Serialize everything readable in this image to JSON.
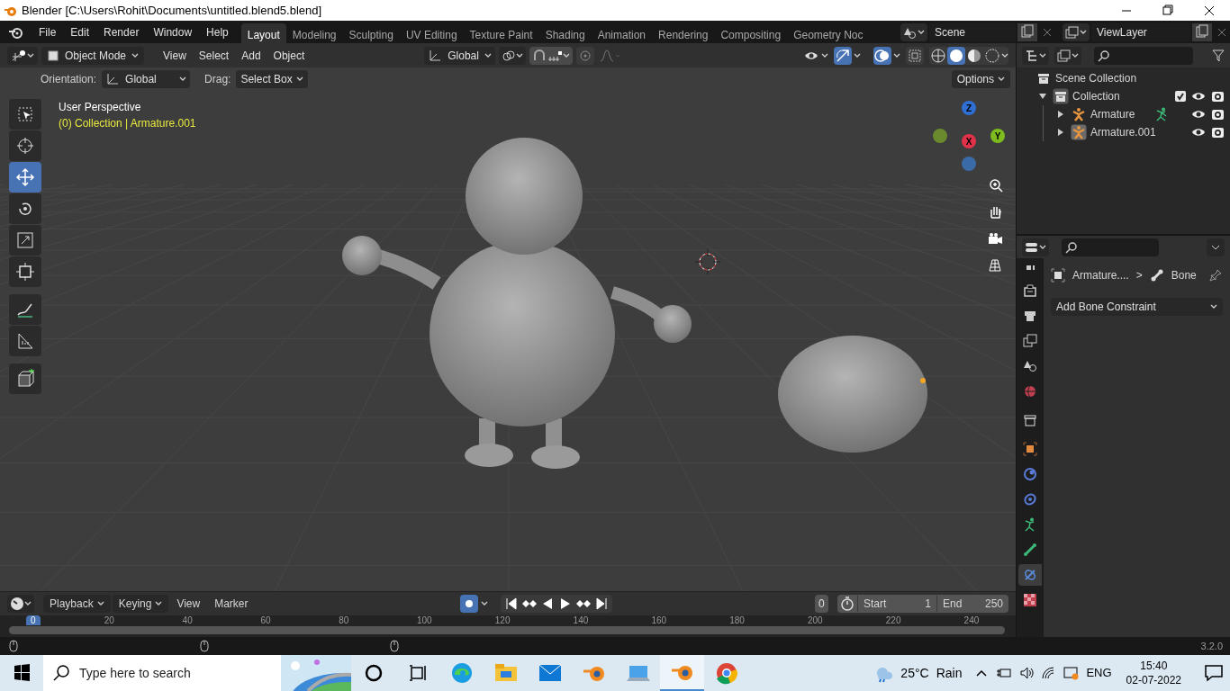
{
  "window": {
    "title": "Blender [C:\\Users\\Rohit\\Documents\\untitled.blend5.blend]"
  },
  "menu": [
    "File",
    "Edit",
    "Render",
    "Window",
    "Help"
  ],
  "workspaces": [
    {
      "label": "Layout",
      "selected": true
    },
    {
      "label": "Modeling",
      "selected": false
    },
    {
      "label": "Sculpting",
      "selected": false
    },
    {
      "label": "UV Editing",
      "selected": false
    },
    {
      "label": "Texture Paint",
      "selected": false
    },
    {
      "label": "Shading",
      "selected": false
    },
    {
      "label": "Animation",
      "selected": false
    },
    {
      "label": "Rendering",
      "selected": false
    },
    {
      "label": "Compositing",
      "selected": false
    },
    {
      "label": "Geometry Noc",
      "selected": false
    }
  ],
  "scene": "Scene",
  "view_layer": "ViewLayer",
  "viewport_header": {
    "mode": "Object Mode",
    "menus": [
      "View",
      "Select",
      "Add",
      "Object"
    ],
    "transform_orientation": "Global",
    "snap": true,
    "gizmos": true,
    "overlays": true,
    "shading": [
      {
        "kind": "wireframe",
        "selected": false
      },
      {
        "kind": "solid",
        "selected": true
      },
      {
        "kind": "material",
        "selected": false
      },
      {
        "kind": "rendered",
        "selected": false
      }
    ]
  },
  "tool_settings": {
    "orientation_label": "Orientation:",
    "orientation": "Global",
    "drag_label": "Drag:",
    "drag": "Select Box",
    "options": "Options"
  },
  "viewport": {
    "perspective": "User Perspective",
    "collection_info": "(0) Collection | Armature.001",
    "gizmo_axes": [
      "Z",
      "X",
      "Y"
    ]
  },
  "tools": [
    {
      "kind": "select",
      "selected": false
    },
    {
      "kind": "cursor",
      "selected": false
    },
    {
      "kind": "move",
      "selected": true
    },
    {
      "kind": "rotate",
      "selected": false
    },
    {
      "kind": "scale",
      "selected": false
    },
    {
      "kind": "transform",
      "selected": false
    },
    {
      "kind": "annotate",
      "selected": false
    },
    {
      "kind": "measure",
      "selected": false
    },
    {
      "kind": "add_cube",
      "selected": false
    }
  ],
  "outliner": {
    "items": [
      {
        "label": "Scene Collection",
        "children": [
          {
            "label": "Collection",
            "expanded": true,
            "checked": true,
            "children": [
              {
                "label": "Armature",
                "expanded": false,
                "pose_mode": true,
                "active": false
              },
              {
                "label": "Armature.001",
                "expanded": false,
                "pose_mode": false,
                "active": true
              }
            ]
          }
        ]
      }
    ]
  },
  "properties": {
    "object": "Armature....",
    "separator": ">",
    "bone": "Bone",
    "add_constraint": "Add Bone Constraint",
    "tabs": [
      {
        "kind": "tool",
        "selected": false
      },
      {
        "kind": "render",
        "selected": false
      },
      {
        "kind": "output",
        "selected": false
      },
      {
        "kind": "view_layer",
        "selected": false
      },
      {
        "kind": "scene",
        "selected": false
      },
      {
        "kind": "world",
        "selected": false
      },
      {
        "kind": "collection",
        "selected": false
      },
      {
        "kind": "object",
        "selected": false
      },
      {
        "kind": "physics",
        "selected": false
      },
      {
        "kind": "constraints",
        "selected": false
      },
      {
        "kind": "armature",
        "selected": false
      },
      {
        "kind": "bone",
        "selected": false
      },
      {
        "kind": "bone_constraints",
        "selected": true
      },
      {
        "kind": "texture",
        "selected": false
      }
    ]
  },
  "timeline": {
    "menus": [
      "Playback",
      "Keying",
      "View",
      "Marker"
    ],
    "auto_keying": true,
    "current_frame": "0",
    "start_label": "Start",
    "start": "1",
    "end_label": "End",
    "end": "250",
    "ruler": [
      "0",
      "20",
      "40",
      "60",
      "80",
      "100",
      "120",
      "140",
      "160",
      "180",
      "200",
      "220",
      "240"
    ]
  },
  "status_bar": {
    "version": "3.2.0"
  },
  "taskbar": {
    "search_placeholder": "Type here to search",
    "temperature": "25°C",
    "condition": "Rain",
    "language": "ENG",
    "time": "15:40",
    "date": "02-07-2022",
    "apps": [
      {
        "kind": "cortana",
        "selected": false
      },
      {
        "kind": "task_view",
        "selected": false
      },
      {
        "kind": "edge",
        "selected": false
      },
      {
        "kind": "explorer",
        "selected": false
      },
      {
        "kind": "mail",
        "selected": false
      },
      {
        "kind": "blender",
        "selected": false
      },
      {
        "kind": "computer",
        "selected": false
      },
      {
        "kind": "blender",
        "selected": true
      },
      {
        "kind": "chrome",
        "selected": false
      }
    ]
  }
}
